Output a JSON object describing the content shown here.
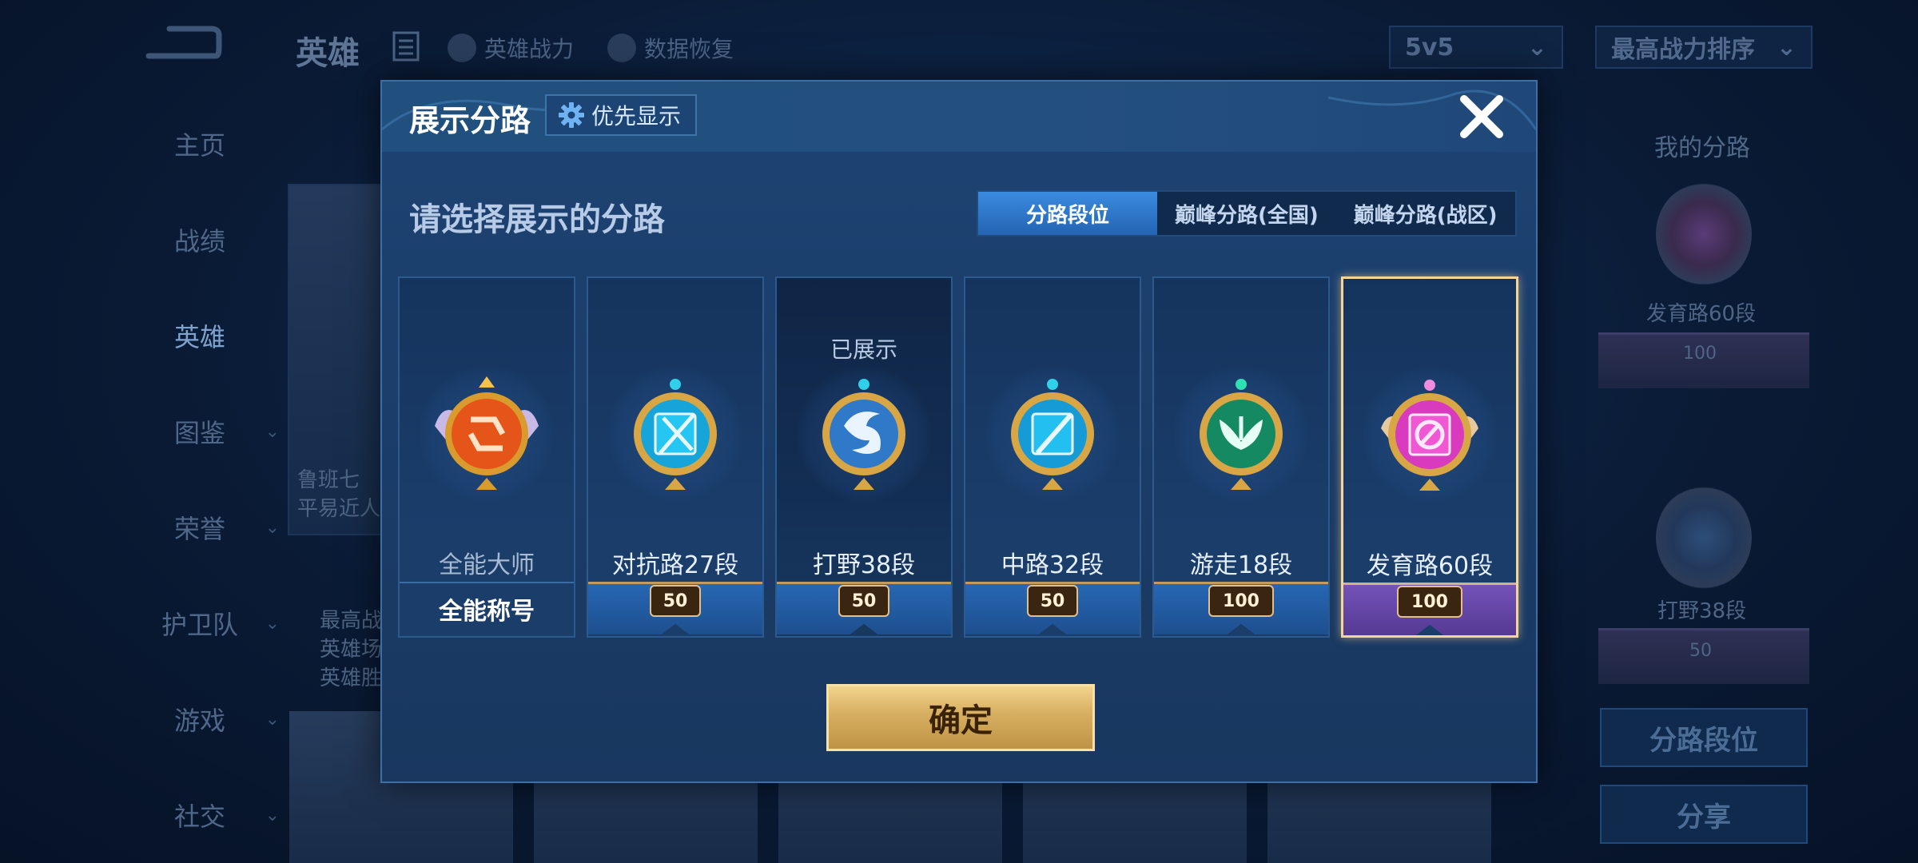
{
  "background": {
    "title": "英雄",
    "tools": [
      {
        "label": "英雄战力",
        "icon": "warrior-icon"
      },
      {
        "label": "数据恢复",
        "icon": "restore-icon"
      }
    ],
    "mode_select": "5v5",
    "sort_select": "最高战力排序",
    "nav": [
      "主页",
      "战绩",
      "英雄",
      "图鉴",
      "荣誉",
      "护卫队",
      "游戏",
      "社交"
    ],
    "hero_card_text": [
      "鲁班七",
      "平易近人"
    ],
    "stats_lines": [
      "最高战",
      "英雄场",
      "英雄胜"
    ],
    "right_panel": {
      "title": "我的分路",
      "items": [
        {
          "label": "发育路60段",
          "rank": "100"
        },
        {
          "label": "打野38段",
          "rank": "50"
        }
      ],
      "buttons": [
        "分路段位",
        "分享"
      ]
    }
  },
  "dialog": {
    "title": "展示分路",
    "priority_label": "优先显示",
    "section_label": "请选择展示的分路",
    "tabs": [
      "分路段位",
      "巅峰分路(全国)",
      "巅峰分路(战区)"
    ],
    "active_tab": 0,
    "cards": [
      {
        "name": "全能大师",
        "footer": "全能称号",
        "rank": null,
        "shown": false,
        "selected": false,
        "emblem_color": "#e05a1a",
        "icon": "all-round-icon"
      },
      {
        "name": "对抗路27段",
        "footer": null,
        "rank": "50",
        "shown": false,
        "selected": false,
        "emblem_color": "#1bb6e6",
        "icon": "clash-lane-icon"
      },
      {
        "name": "打野38段",
        "footer": null,
        "rank": "50",
        "shown": true,
        "shown_label": "已展示",
        "selected": false,
        "emblem_color": "#3a86d6",
        "icon": "jungle-icon"
      },
      {
        "name": "中路32段",
        "footer": null,
        "rank": "50",
        "shown": false,
        "selected": false,
        "emblem_color": "#1aa5e0",
        "icon": "mid-lane-icon"
      },
      {
        "name": "游走18段",
        "footer": null,
        "rank": "100",
        "shown": false,
        "selected": false,
        "emblem_color": "#1d9e6e",
        "icon": "roam-icon"
      },
      {
        "name": "发育路60段",
        "footer": null,
        "rank": "100",
        "shown": false,
        "selected": true,
        "emblem_color": "#e23fc1",
        "icon": "farm-lane-icon"
      }
    ],
    "confirm_label": "确定"
  }
}
